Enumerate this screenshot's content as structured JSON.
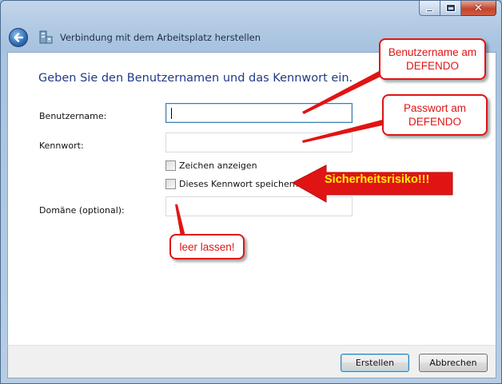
{
  "window": {
    "title": "Verbindung mit dem Arbeitsplatz herstellen"
  },
  "dialog": {
    "instruction": "Geben Sie den Benutzernamen und das Kennwort ein.",
    "username_label": "Benutzername:",
    "username_value": "",
    "password_label": "Kennwort:",
    "password_value": "",
    "show_chars_label": "Zeichen anzeigen",
    "save_password_label": "Dieses Kennwort speichern",
    "domain_label": "Domäne (optional):",
    "domain_value": ""
  },
  "buttons": {
    "create": "Erstellen",
    "cancel": "Abbrechen"
  },
  "annotations": {
    "username_note": "Benutzername am DEFENDO",
    "password_note": "Passwort am DEFENDO",
    "risk_note": "Sicherheitsrisiko!!!",
    "domain_note": "leer lassen!",
    "color": "#e11414",
    "risk_text_color": "#fff200"
  },
  "icons": {
    "back": "back-arrow-icon",
    "connection": "workplace-connection-icon"
  }
}
